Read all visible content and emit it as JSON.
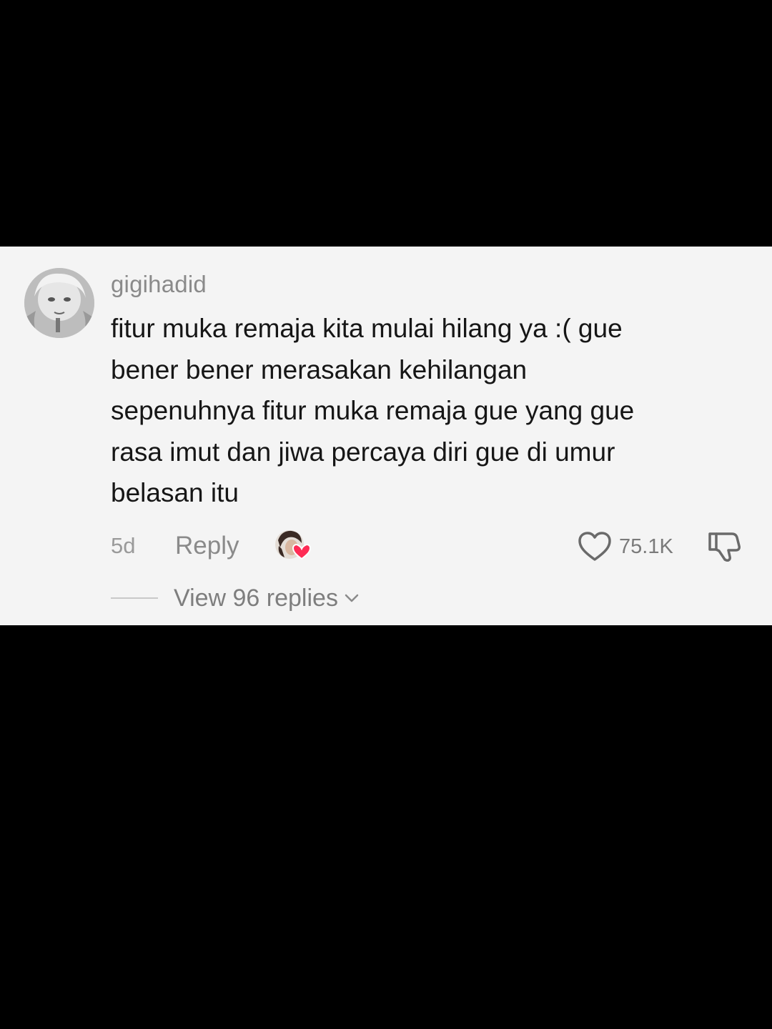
{
  "comment": {
    "username": "gigihadid",
    "text_lines": [
      "fitur muka remaja kita mulai hilang ya :( gue",
      "bener bener merasakan kehilangan",
      "sepenuhnya fitur muka remaja gue yang gue",
      "rasa imut dan jiwa percaya diri gue di umur",
      "belasan itu"
    ],
    "time_ago": "5d",
    "reply_label": "Reply",
    "like_count": "75.1K",
    "view_replies_label": "View 96 replies",
    "liked_by_creator": true
  },
  "icons": {
    "avatar": "user-avatar",
    "creator_liked": "creator-liked-avatar-heart",
    "like": "heart-outline-icon",
    "dislike": "thumbs-down-icon",
    "expand": "chevron-down-icon"
  },
  "colors": {
    "background": "#000000",
    "card": "#f4f4f4",
    "text": "#161616",
    "muted": "#8a8a8a",
    "heart_accent": "#fe2c55"
  }
}
